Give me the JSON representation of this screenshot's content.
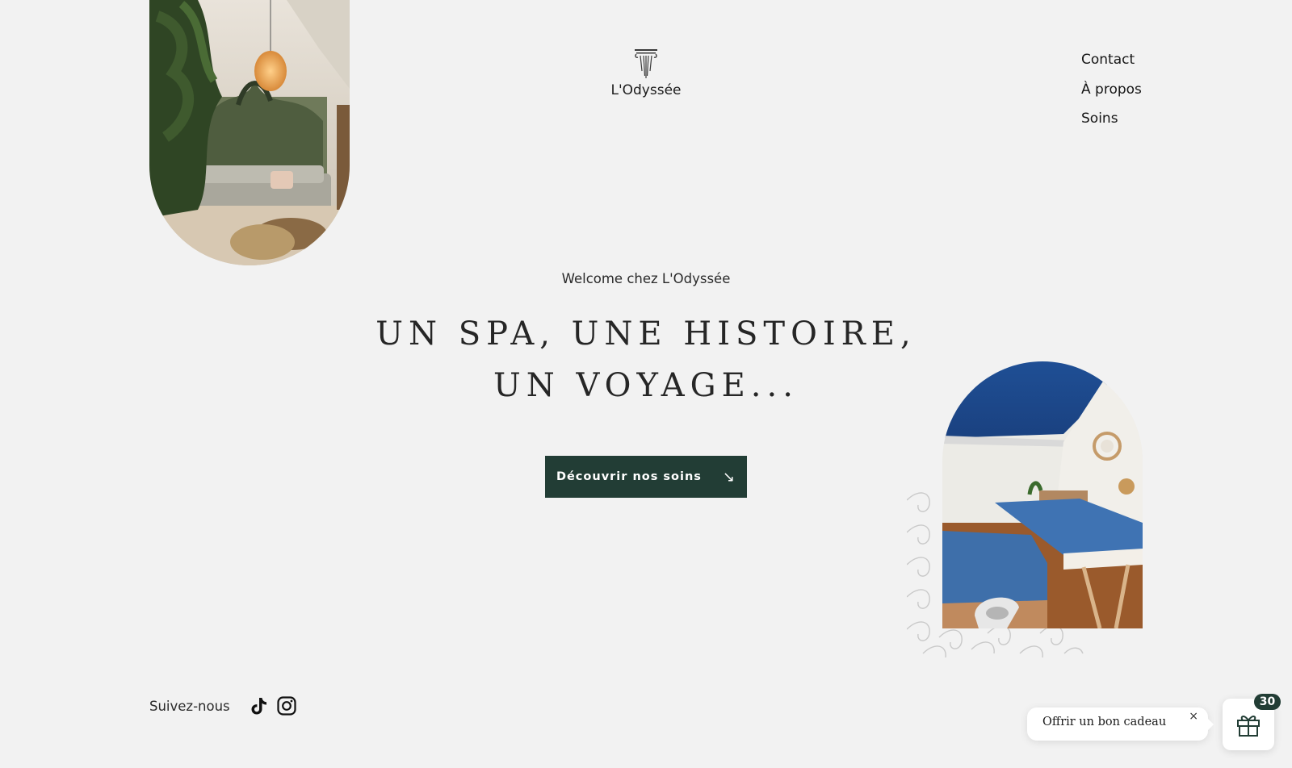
{
  "site": {
    "name": "L'Odyssée",
    "logo_icon": "ionic-column-icon"
  },
  "nav": {
    "items": [
      {
        "label": "Contact"
      },
      {
        "label": "À propos"
      },
      {
        "label": "Soins"
      }
    ]
  },
  "hero": {
    "welcome": "Welcome chez L'Odyssée",
    "headline_line1": "UN SPA, UNE HISTOIRE,",
    "headline_line2": "UN VOYAGE...",
    "cta_label": "Découvrir nos soins",
    "cta_icon": "arrow-down-right-icon"
  },
  "footer": {
    "follow_label": "Suivez-nous",
    "socials": [
      {
        "icon": "tiktok-icon"
      },
      {
        "icon": "instagram-icon"
      }
    ]
  },
  "gift": {
    "label": "Offrir un bon cadeau",
    "close": "×",
    "badge": "30",
    "icon": "gift-icon"
  },
  "colors": {
    "background": "#f2f2f2",
    "accent": "#223d35"
  }
}
